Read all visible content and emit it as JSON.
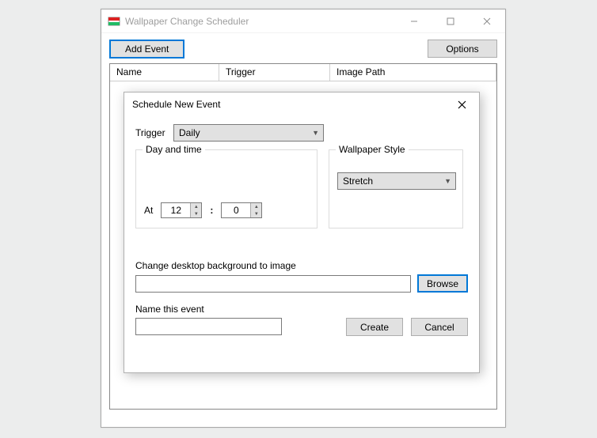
{
  "window": {
    "title": "Wallpaper Change Scheduler"
  },
  "toolbar": {
    "add_event": "Add Event",
    "options": "Options"
  },
  "grid": {
    "columns": {
      "name": "Name",
      "trigger": "Trigger",
      "path": "Image Path"
    }
  },
  "dialog": {
    "title": "Schedule New Event",
    "trigger_label": "Trigger",
    "trigger_value": "Daily",
    "day_time_legend": "Day and time",
    "at_label": "At",
    "hour_value": "12",
    "minute_value": "0",
    "colon": ":",
    "style_legend": "Wallpaper Style",
    "style_value": "Stretch",
    "change_label": "Change desktop background to image",
    "image_path_value": "",
    "browse": "Browse",
    "name_label": "Name this event",
    "name_value": "",
    "create": "Create",
    "cancel": "Cancel"
  }
}
